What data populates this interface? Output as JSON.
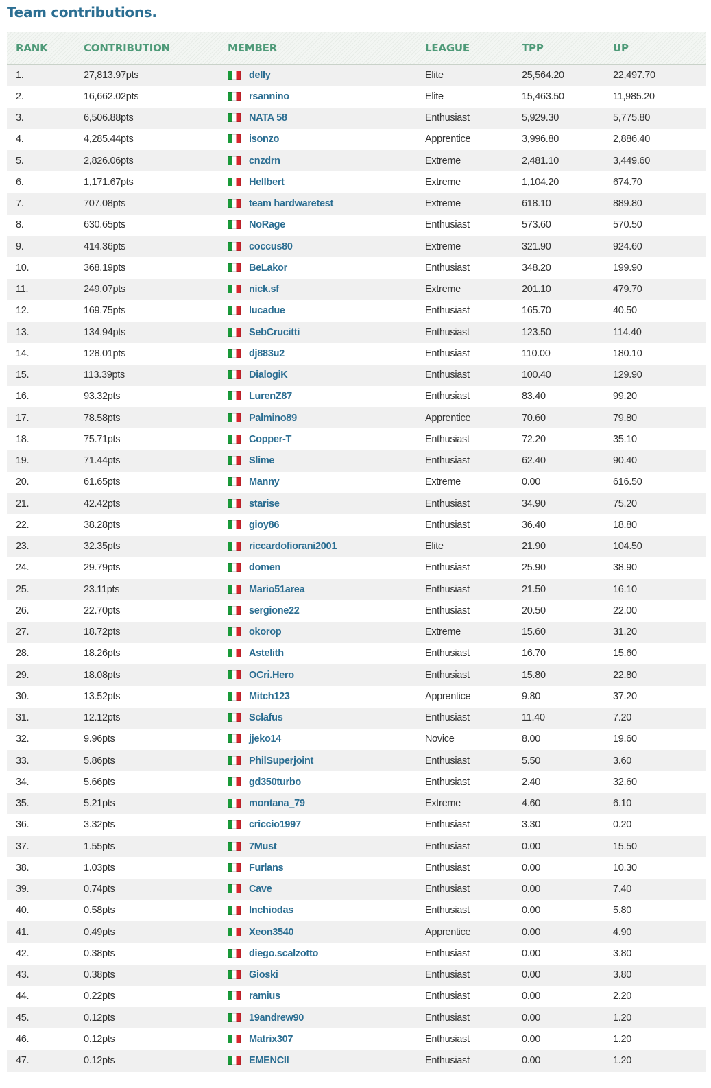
{
  "title": "Team contributions.",
  "flag_icon": "italy-flag-icon",
  "headers": {
    "rank": "RANK",
    "contribution": "CONTRIBUTION",
    "member": "MEMBER",
    "league": "LEAGUE",
    "tpp": "TPP",
    "up": "UP"
  },
  "rows": [
    {
      "rank": "1.",
      "contribution": "27,813.97pts",
      "member": "delly",
      "league": "Elite",
      "tpp": "25,564.20",
      "up": "22,497.70"
    },
    {
      "rank": "2.",
      "contribution": "16,662.02pts",
      "member": "rsannino",
      "league": "Elite",
      "tpp": "15,463.50",
      "up": "11,985.20"
    },
    {
      "rank": "3.",
      "contribution": "6,506.88pts",
      "member": "NATA 58",
      "league": "Enthusiast",
      "tpp": "5,929.30",
      "up": "5,775.80"
    },
    {
      "rank": "4.",
      "contribution": "4,285.44pts",
      "member": "isonzo",
      "league": "Apprentice",
      "tpp": "3,996.80",
      "up": "2,886.40"
    },
    {
      "rank": "5.",
      "contribution": "2,826.06pts",
      "member": "cnzdrn",
      "league": "Extreme",
      "tpp": "2,481.10",
      "up": "3,449.60"
    },
    {
      "rank": "6.",
      "contribution": "1,171.67pts",
      "member": "Hellbert",
      "league": "Extreme",
      "tpp": "1,104.20",
      "up": "674.70"
    },
    {
      "rank": "7.",
      "contribution": "707.08pts",
      "member": "team hardwaretest",
      "league": "Extreme",
      "tpp": "618.10",
      "up": "889.80"
    },
    {
      "rank": "8.",
      "contribution": "630.65pts",
      "member": "NoRage",
      "league": "Enthusiast",
      "tpp": "573.60",
      "up": "570.50"
    },
    {
      "rank": "9.",
      "contribution": "414.36pts",
      "member": "coccus80",
      "league": "Extreme",
      "tpp": "321.90",
      "up": "924.60"
    },
    {
      "rank": "10.",
      "contribution": "368.19pts",
      "member": "BeLakor",
      "league": "Enthusiast",
      "tpp": "348.20",
      "up": "199.90"
    },
    {
      "rank": "11.",
      "contribution": "249.07pts",
      "member": "nick.sf",
      "league": "Extreme",
      "tpp": "201.10",
      "up": "479.70"
    },
    {
      "rank": "12.",
      "contribution": "169.75pts",
      "member": "lucadue",
      "league": "Enthusiast",
      "tpp": "165.70",
      "up": "40.50"
    },
    {
      "rank": "13.",
      "contribution": "134.94pts",
      "member": "SebCrucitti",
      "league": "Enthusiast",
      "tpp": "123.50",
      "up": "114.40"
    },
    {
      "rank": "14.",
      "contribution": "128.01pts",
      "member": "dj883u2",
      "league": "Enthusiast",
      "tpp": "110.00",
      "up": "180.10"
    },
    {
      "rank": "15.",
      "contribution": "113.39pts",
      "member": "DialogiK",
      "league": "Enthusiast",
      "tpp": "100.40",
      "up": "129.90"
    },
    {
      "rank": "16.",
      "contribution": "93.32pts",
      "member": "LurenZ87",
      "league": "Enthusiast",
      "tpp": "83.40",
      "up": "99.20"
    },
    {
      "rank": "17.",
      "contribution": "78.58pts",
      "member": "Palmino89",
      "league": "Apprentice",
      "tpp": "70.60",
      "up": "79.80"
    },
    {
      "rank": "18.",
      "contribution": "75.71pts",
      "member": "Copper-T",
      "league": "Enthusiast",
      "tpp": "72.20",
      "up": "35.10"
    },
    {
      "rank": "19.",
      "contribution": "71.44pts",
      "member": "Slime",
      "league": "Enthusiast",
      "tpp": "62.40",
      "up": "90.40"
    },
    {
      "rank": "20.",
      "contribution": "61.65pts",
      "member": "Manny",
      "league": "Extreme",
      "tpp": "0.00",
      "up": "616.50"
    },
    {
      "rank": "21.",
      "contribution": "42.42pts",
      "member": "starise",
      "league": "Enthusiast",
      "tpp": "34.90",
      "up": "75.20"
    },
    {
      "rank": "22.",
      "contribution": "38.28pts",
      "member": "gioy86",
      "league": "Enthusiast",
      "tpp": "36.40",
      "up": "18.80"
    },
    {
      "rank": "23.",
      "contribution": "32.35pts",
      "member": "riccardofiorani2001",
      "league": "Elite",
      "tpp": "21.90",
      "up": "104.50"
    },
    {
      "rank": "24.",
      "contribution": "29.79pts",
      "member": "domen",
      "league": "Enthusiast",
      "tpp": "25.90",
      "up": "38.90"
    },
    {
      "rank": "25.",
      "contribution": "23.11pts",
      "member": "Mario51area",
      "league": "Enthusiast",
      "tpp": "21.50",
      "up": "16.10"
    },
    {
      "rank": "26.",
      "contribution": "22.70pts",
      "member": "sergione22",
      "league": "Enthusiast",
      "tpp": "20.50",
      "up": "22.00"
    },
    {
      "rank": "27.",
      "contribution": "18.72pts",
      "member": "okorop",
      "league": "Extreme",
      "tpp": "15.60",
      "up": "31.20"
    },
    {
      "rank": "28.",
      "contribution": "18.26pts",
      "member": "Astelith",
      "league": "Enthusiast",
      "tpp": "16.70",
      "up": "15.60"
    },
    {
      "rank": "29.",
      "contribution": "18.08pts",
      "member": "OCri.Hero",
      "league": "Enthusiast",
      "tpp": "15.80",
      "up": "22.80"
    },
    {
      "rank": "30.",
      "contribution": "13.52pts",
      "member": "Mitch123",
      "league": "Apprentice",
      "tpp": "9.80",
      "up": "37.20"
    },
    {
      "rank": "31.",
      "contribution": "12.12pts",
      "member": "Sclafus",
      "league": "Enthusiast",
      "tpp": "11.40",
      "up": "7.20"
    },
    {
      "rank": "32.",
      "contribution": "9.96pts",
      "member": "jjeko14",
      "league": "Novice",
      "tpp": "8.00",
      "up": "19.60"
    },
    {
      "rank": "33.",
      "contribution": "5.86pts",
      "member": "PhilSuperjoint",
      "league": "Enthusiast",
      "tpp": "5.50",
      "up": "3.60"
    },
    {
      "rank": "34.",
      "contribution": "5.66pts",
      "member": "gd350turbo",
      "league": "Enthusiast",
      "tpp": "2.40",
      "up": "32.60"
    },
    {
      "rank": "35.",
      "contribution": "5.21pts",
      "member": "montana_79",
      "league": "Extreme",
      "tpp": "4.60",
      "up": "6.10"
    },
    {
      "rank": "36.",
      "contribution": "3.32pts",
      "member": "criccio1997",
      "league": "Enthusiast",
      "tpp": "3.30",
      "up": "0.20"
    },
    {
      "rank": "37.",
      "contribution": "1.55pts",
      "member": "7Must",
      "league": "Enthusiast",
      "tpp": "0.00",
      "up": "15.50"
    },
    {
      "rank": "38.",
      "contribution": "1.03pts",
      "member": "Furlans",
      "league": "Enthusiast",
      "tpp": "0.00",
      "up": "10.30"
    },
    {
      "rank": "39.",
      "contribution": "0.74pts",
      "member": "Cave",
      "league": "Enthusiast",
      "tpp": "0.00",
      "up": "7.40"
    },
    {
      "rank": "40.",
      "contribution": "0.58pts",
      "member": "Inchiodas",
      "league": "Enthusiast",
      "tpp": "0.00",
      "up": "5.80"
    },
    {
      "rank": "41.",
      "contribution": "0.49pts",
      "member": "Xeon3540",
      "league": "Apprentice",
      "tpp": "0.00",
      "up": "4.90"
    },
    {
      "rank": "42.",
      "contribution": "0.38pts",
      "member": "diego.scalzotto",
      "league": "Enthusiast",
      "tpp": "0.00",
      "up": "3.80"
    },
    {
      "rank": "43.",
      "contribution": "0.38pts",
      "member": "Gioski",
      "league": "Enthusiast",
      "tpp": "0.00",
      "up": "3.80"
    },
    {
      "rank": "44.",
      "contribution": "0.22pts",
      "member": "ramius",
      "league": "Enthusiast",
      "tpp": "0.00",
      "up": "2.20"
    },
    {
      "rank": "45.",
      "contribution": "0.12pts",
      "member": "19andrew90",
      "league": "Enthusiast",
      "tpp": "0.00",
      "up": "1.20"
    },
    {
      "rank": "46.",
      "contribution": "0.12pts",
      "member": "Matrix307",
      "league": "Enthusiast",
      "tpp": "0.00",
      "up": "1.20"
    },
    {
      "rank": "47.",
      "contribution": "0.12pts",
      "member": "EMENCII",
      "league": "Enthusiast",
      "tpp": "0.00",
      "up": "1.20"
    }
  ]
}
